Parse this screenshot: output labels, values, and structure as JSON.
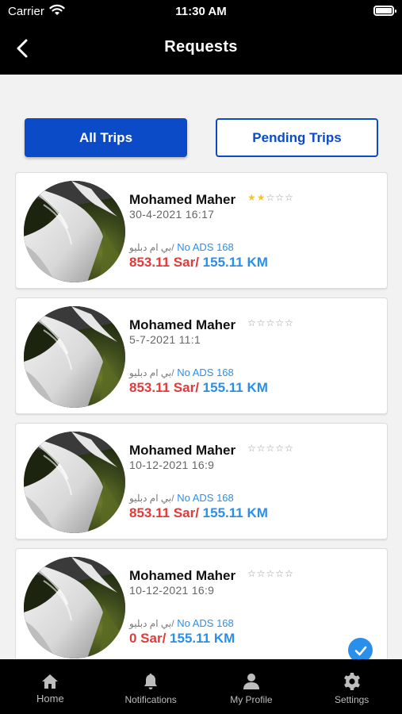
{
  "status_bar": {
    "carrier": "Carrier",
    "time": "11:30 AM",
    "battery_level": 1.0
  },
  "header": {
    "title": "Requests",
    "back_icon": "chevron-left-icon"
  },
  "tabs": {
    "all": "All Trips",
    "pending": "Pending Trips",
    "selected": "All Trips"
  },
  "colors": {
    "primary": "#0b4bc7",
    "price": "#e23a3a",
    "distance": "#2a8fe8",
    "star": "#f2c62e"
  },
  "trips": [
    {
      "name": "Mohamed Maher",
      "rating": 2,
      "date": "30-4-2021 16:17",
      "car_ar": "بي ام دبليو/",
      "ads": "No ADS 168",
      "price": "853.11 Sar/",
      "distance": "155.11 KM",
      "checked": false
    },
    {
      "name": "Mohamed Maher",
      "rating": 0,
      "date": "5-7-2021  11:1",
      "car_ar": "بي ام دبليو/",
      "ads": "No ADS 168",
      "price": "853.11 Sar/",
      "distance": "155.11 KM",
      "checked": false
    },
    {
      "name": "Mohamed Maher",
      "rating": 0,
      "date": "10-12-2021  16:9",
      "car_ar": "بي ام دبليو/",
      "ads": "No ADS 168",
      "price": "853.11 Sar/",
      "distance": "155.11 KM",
      "checked": false
    },
    {
      "name": "Mohamed Maher",
      "rating": 0,
      "date": "10-12-2021  16:9",
      "car_ar": "بي ام دبليو/",
      "ads": "No ADS 168",
      "price": "0 Sar/",
      "distance": "155.11 KM",
      "checked": true
    }
  ],
  "tabbar": [
    {
      "label": "Home",
      "icon": "home-icon"
    },
    {
      "label": "Notifications",
      "icon": "bell-icon"
    },
    {
      "label": "My Profile",
      "icon": "person-icon"
    },
    {
      "label": "Settings",
      "icon": "gear-icon"
    }
  ]
}
